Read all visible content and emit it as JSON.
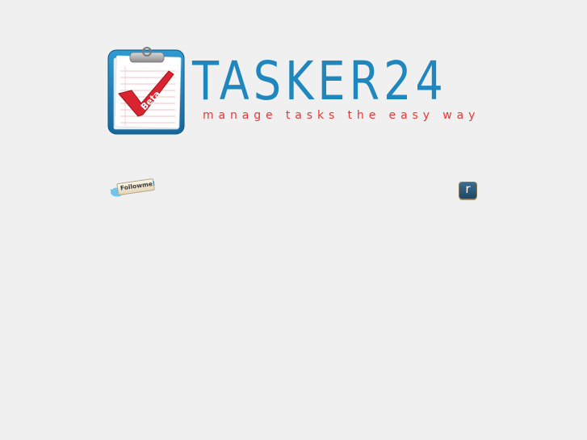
{
  "header": {
    "brand_name": "TASKER24",
    "tagline": "manage tasks the easy way",
    "logo_label": "Beta"
  },
  "social": {
    "follow_label": "Followme",
    "follow_suffix": "!",
    "r_badge_letter": "r"
  },
  "colors": {
    "background": "#f0f0f0",
    "brand_blue": "#1f87bd",
    "tagline_red": "#e13a3a",
    "checkmark_red": "#d9232e"
  }
}
